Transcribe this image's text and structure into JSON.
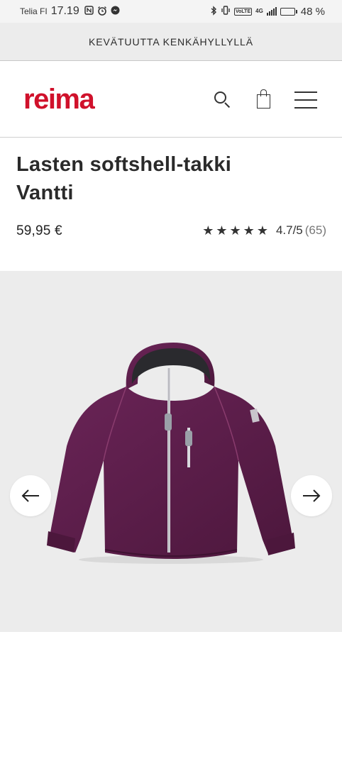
{
  "status_bar": {
    "carrier": "Telia FI",
    "time": "17.19",
    "battery_percent": "48 %",
    "battery_level": 0.48,
    "icons": [
      "nfc-icon",
      "alarm-icon",
      "messenger-icon",
      "bluetooth-icon",
      "vibrate-icon",
      "volte-icon",
      "signal-icon",
      "battery-icon"
    ],
    "volte_label": "VoLTE",
    "network_label": "4G"
  },
  "promo_banner": {
    "text": "KEVÄTUUTTA KENKÄHYLLYLLÄ"
  },
  "header": {
    "logo": "reima",
    "brand_color": "#d0112b",
    "icons": [
      "search-icon",
      "shopping-bag-icon",
      "hamburger-menu-icon"
    ]
  },
  "product": {
    "title_line1": "Lasten softshell-takki",
    "title_line2": "Vantti",
    "price": "59,95 €",
    "rating_value": 4.7,
    "rating_text": "4.7/5",
    "rating_count": "(65)",
    "star_count": 5,
    "jacket_color": "#5a1d48"
  },
  "gallery": {
    "icons": [
      "arrow-left-icon",
      "arrow-right-icon"
    ],
    "background": "#ececec"
  }
}
